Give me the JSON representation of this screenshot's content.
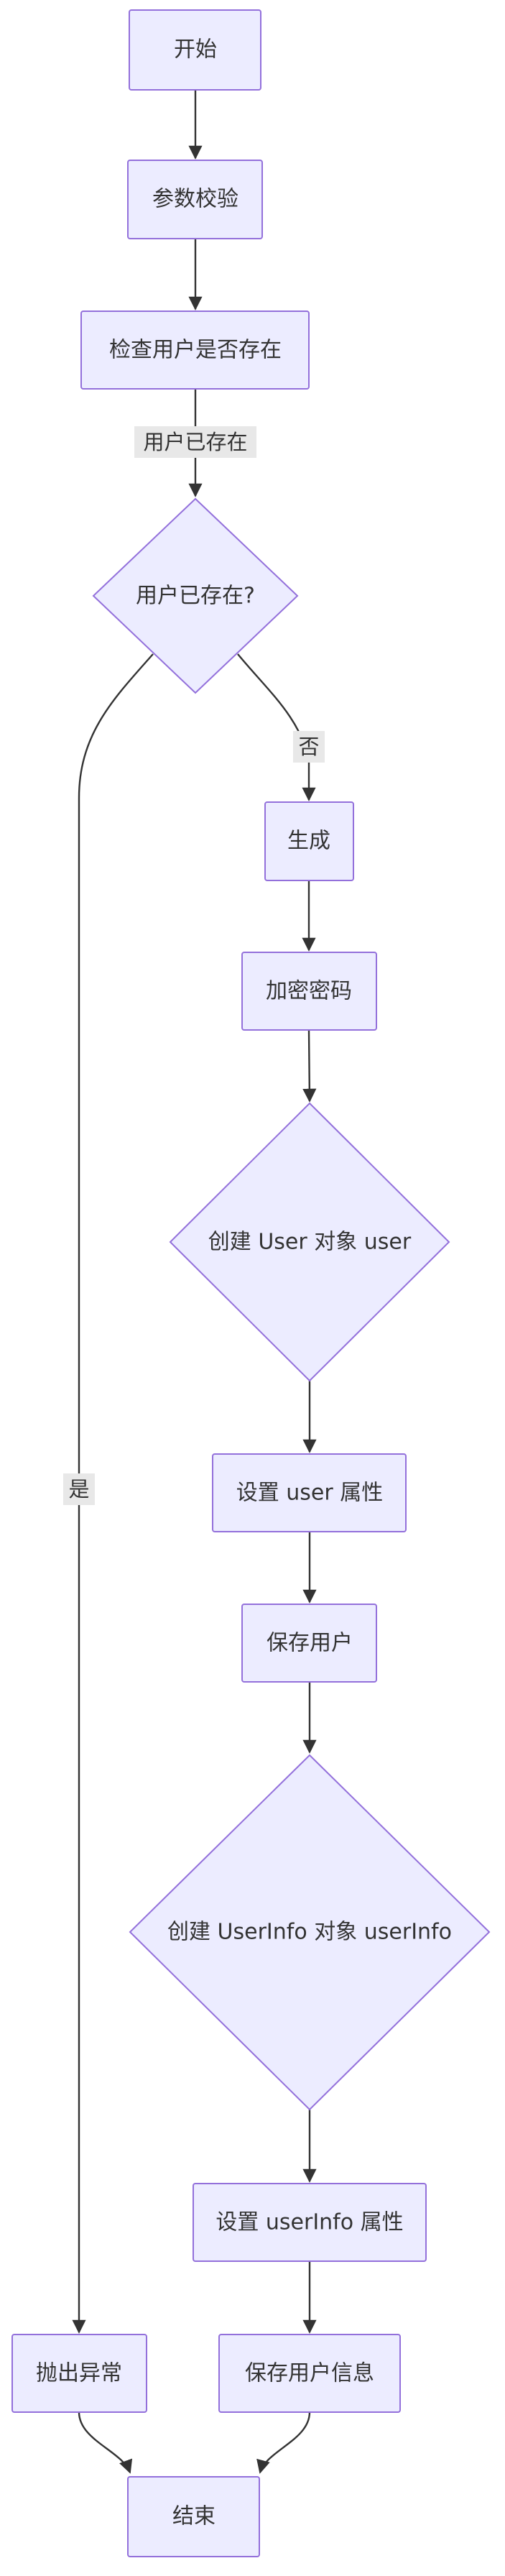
{
  "nodes": {
    "start": "开始",
    "validate": "参数校验",
    "check_user": "检查用户是否存在",
    "user_exists_decision": "用户已存在?",
    "generate": "生成",
    "encrypt_password": "加密密码",
    "create_user": "创建 User 对象 user",
    "set_user_props": "设置 user 属性",
    "save_user": "保存用户",
    "create_userinfo": "创建 UserInfo 对象 userInfo",
    "set_userinfo_props": "设置 userInfo 属性",
    "throw_exception": "抛出异常",
    "save_userinfo": "保存用户信息",
    "end": "结束"
  },
  "edges": {
    "check_to_decision": "用户已存在",
    "decision_no": "否",
    "decision_yes": "是"
  }
}
